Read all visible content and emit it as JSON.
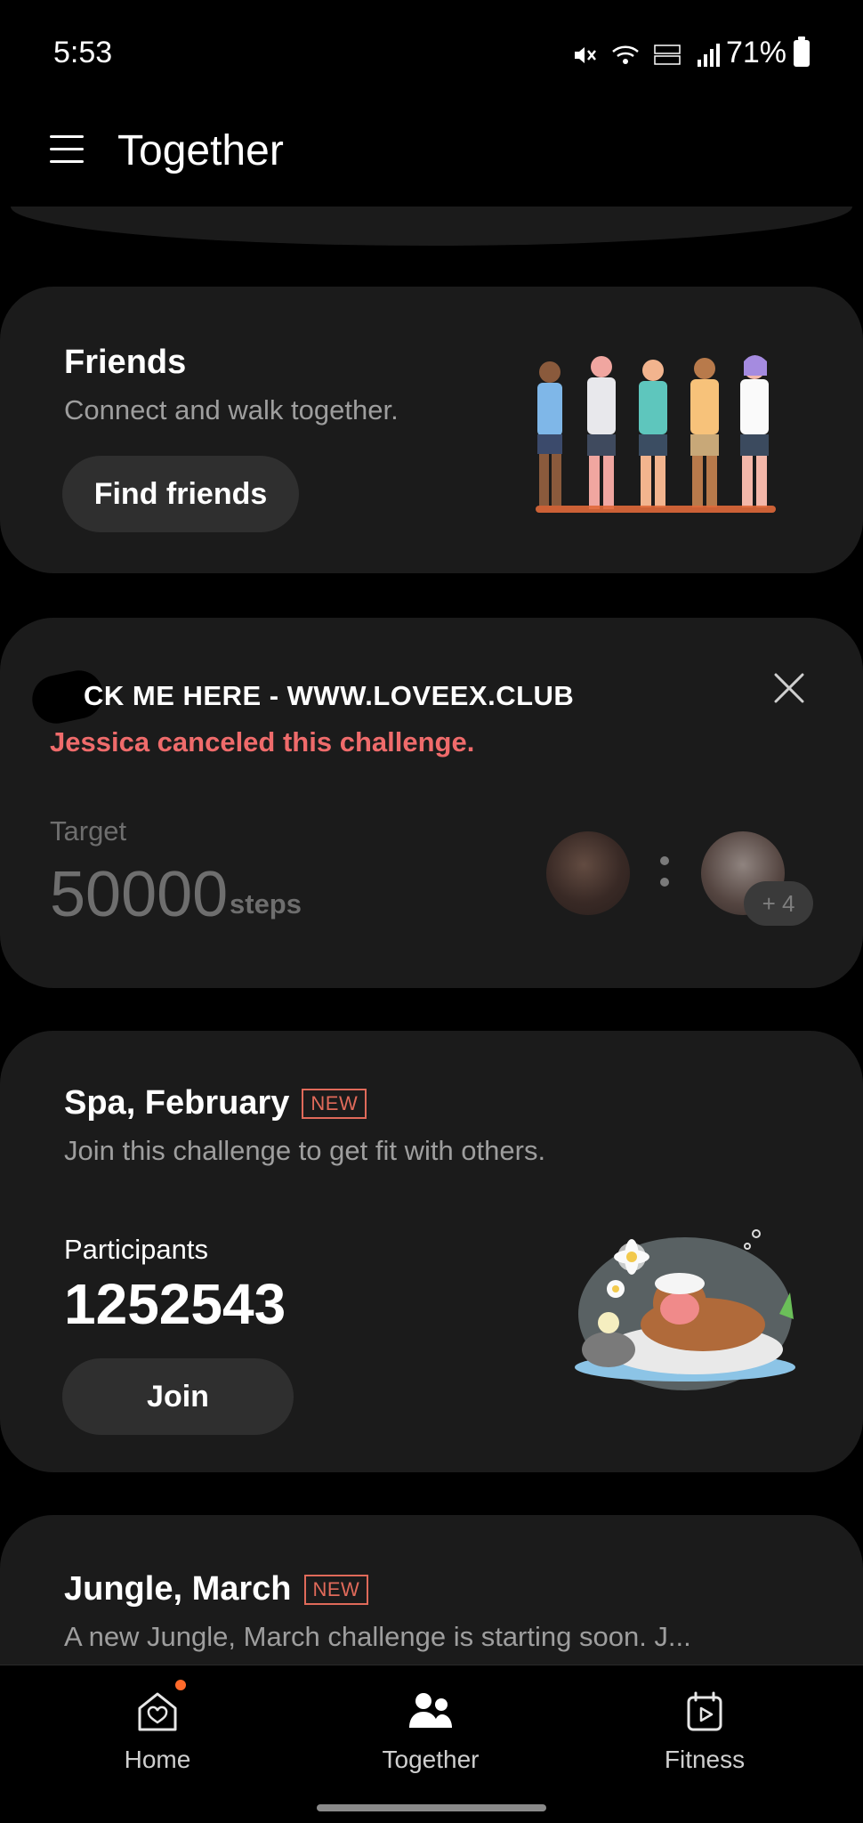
{
  "status_bar": {
    "time": "5:53",
    "battery": "71%"
  },
  "app_bar": {
    "title": "Together"
  },
  "friends_card": {
    "title": "Friends",
    "subtitle": "Connect and walk together.",
    "button": "Find friends"
  },
  "challenge_card": {
    "promo": "CK ME HERE - WWW.LOVEEX.CLUB",
    "status": "Jessica canceled this challenge.",
    "target_label": "Target",
    "target_value": "50000",
    "target_unit": "steps",
    "extra_participants": "+ 4"
  },
  "spa_card": {
    "title": "Spa, February",
    "badge": "NEW",
    "subtitle": "Join this challenge to get fit with others.",
    "participants_label": "Participants",
    "participants_value": "1252543",
    "button": "Join"
  },
  "jungle_card": {
    "title": "Jungle, March",
    "badge": "NEW",
    "subtitle": "A new Jungle, March challenge is starting soon. J..."
  },
  "bottom_nav": {
    "items": [
      {
        "label": "Home",
        "icon": "home-icon"
      },
      {
        "label": "Together",
        "icon": "people-icon"
      },
      {
        "label": "Fitness",
        "icon": "fitness-icon"
      }
    ]
  },
  "colors": {
    "background": "#000000",
    "card": "#1b1b1b",
    "button": "#2f2f2f",
    "alert": "#ef6b6b",
    "badge": "#e06a5a",
    "notification_dot": "#ff6a2b"
  }
}
